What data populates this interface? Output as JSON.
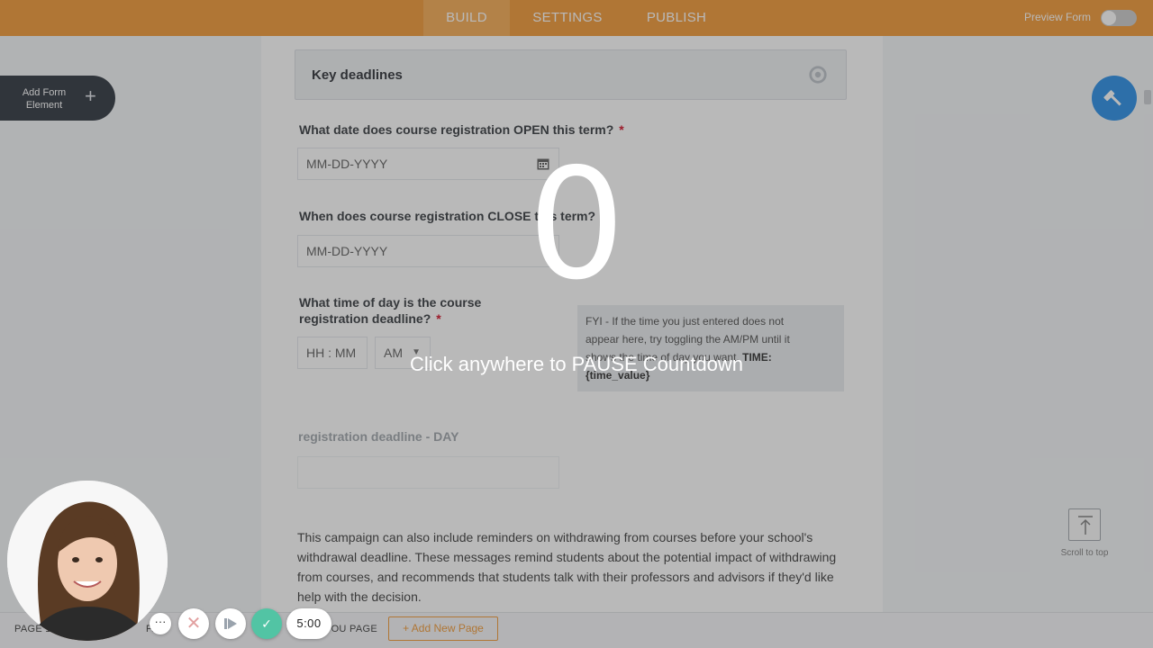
{
  "topbar": {
    "tabs": [
      {
        "label": "BUILD"
      },
      {
        "label": "SETTINGS"
      },
      {
        "label": "PUBLISH"
      }
    ],
    "preview_label": "Preview Form"
  },
  "left_panel": {
    "add_element_label": "Add Form Element",
    "add_element_icon": "+"
  },
  "form": {
    "section_title": "Key deadlines",
    "q1": {
      "label": "What date does course registration OPEN this term?",
      "required": "*",
      "placeholder": "MM-DD-YYYY"
    },
    "q2": {
      "label": "When does course registration CLOSE this term?",
      "placeholder": "MM-DD-YYYY"
    },
    "q3": {
      "label_line1": "What time of day is the course",
      "label_line2": "registration deadline?",
      "required": "*",
      "time_placeholder": "HH : MM",
      "ampm_value": "AM"
    },
    "fyi": {
      "line1": "FYI - If the time you just entered does not",
      "line2": "appear here, try toggling the AM/PM until it",
      "line3_start": "shows the time of day you want.",
      "time_label": "TIME:",
      "line4": "{time_value}"
    },
    "q4_label": "registration deadline - DAY",
    "paragraph": "This campaign can also include reminders on withdrawing from courses before your school's withdrawal deadline. These messages remind students about the potential impact of withdrawing from courses, and recommends that students talk with their professors and advisors if they'd like help with the decision."
  },
  "right_panel": {
    "scroll_top_label": "Scroll to top"
  },
  "bottombar": {
    "page1": "PAGE 1",
    "page2": "PA",
    "thankyou": "THANK YOU PAGE",
    "add_page": "+ Add New Page"
  },
  "overlay": {
    "countdown": "0",
    "message": "Click anywhere to PAUSE Countdown"
  },
  "recorder": {
    "more_label": "···",
    "timer": "5:00"
  },
  "colors": {
    "brand_orange": "#f0932b",
    "accent_blue": "#1e88e5",
    "done_green": "#52c4a4"
  }
}
